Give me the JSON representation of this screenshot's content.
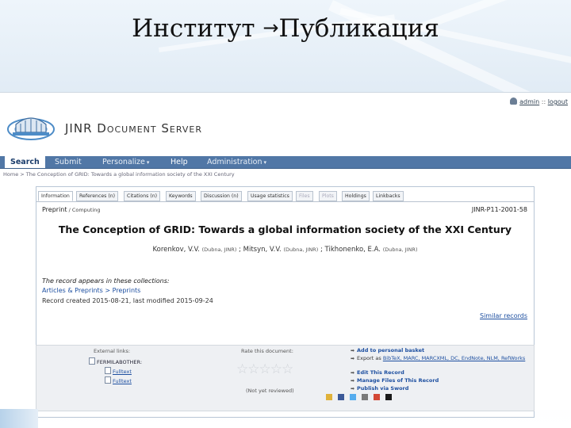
{
  "slide": {
    "title_left": "Институт",
    "arrow": "→",
    "title_right": "Публикация"
  },
  "topbar": {
    "user": "admin",
    "logout": "logout",
    "separator": "::"
  },
  "brand": {
    "name_big_1": "JINR D",
    "name_small_1": "OCUMENT",
    "name_big_2": " S",
    "name_small_2": "ERVER"
  },
  "nav": {
    "search": "Search",
    "submit": "Submit",
    "personalize": "Personalize",
    "help": "Help",
    "administration": "Administration",
    "caret": "▾"
  },
  "breadcrumb": "Home > The Conception of GRID: Towards a global information society of the XXI Century",
  "tabs": [
    "Information",
    "References (n)",
    "Citations (n)",
    "Keywords",
    "Discussion (n)",
    "Usage statistics",
    "Files",
    "Plots",
    "Holdings",
    "Linkbacks"
  ],
  "record": {
    "category": "Preprint",
    "subcategory": " / Computing",
    "number": "JINR-P11-2001-58",
    "title": "The Conception of GRID: Towards a global information society of the XXI Century",
    "authors": [
      {
        "name": "Korenkov, V.V.",
        "aff": "(Dubna, JINR)",
        "sep": " ; "
      },
      {
        "name": "Mitsyn, V.V.",
        "aff": "(Dubna, JINR)",
        "sep": " ; "
      },
      {
        "name": "Tikhonenko, E.A.",
        "aff": "(Dubna, JINR)",
        "sep": ""
      }
    ],
    "collections_label": "The record appears in these collections:",
    "collections": "Articles & Preprints > Preprints",
    "created": "Record created 2015-08-21, last modified 2015-09-24",
    "similar": "Similar records"
  },
  "external": {
    "title": "External links:",
    "source": "FERMILABOTHER:",
    "links": [
      "Fulltext",
      "Fulltext"
    ]
  },
  "rating": {
    "title": "Rate this document:",
    "stars": "☆☆☆☆☆",
    "status": "(Not yet reviewed)"
  },
  "actions": {
    "add_basket": "Add to personal basket",
    "export_label": "Export as ",
    "export_formats": "BibTeX, MARC, MARCXML, DC, EndNote, NLM, RefWorks",
    "edit": "Edit This Record",
    "manage_files": "Manage Files of This Record",
    "publish": "Publish via Sword",
    "bullet": "➡"
  },
  "colors": {
    "nav": "#5177a6",
    "link": "#1d4fa0",
    "border": "#b8c6d6"
  }
}
